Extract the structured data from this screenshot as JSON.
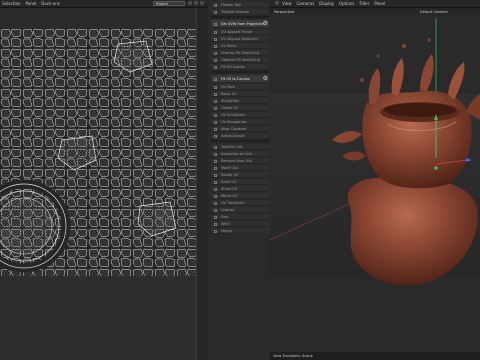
{
  "menubar": {
    "left_items": [
      "Selection",
      "Panel",
      "Dock-ons"
    ],
    "project_select": "Project",
    "right_items": [
      "View",
      "Cameras",
      "Display",
      "Options",
      "Filter",
      "Panel"
    ]
  },
  "tools": {
    "items": [
      {
        "label": "Flatten Tool"
      },
      {
        "label": "Triangle Unwrap"
      },
      {
        "label": "Set UVW from Projection",
        "highlight": true
      },
      {
        "label": "UV Aligned Planar"
      },
      {
        "label": "UV Aligned Spherical"
      },
      {
        "label": "UV Relax"
      },
      {
        "label": "Unwrap Fill Stretching"
      },
      {
        "label": "Optimal Fill Stretching"
      },
      {
        "label": "Fill UV Islands"
      },
      {
        "label": "Fit UV to Canvas",
        "highlight": true
      },
      {
        "label": "UV Pack"
      },
      {
        "label": "Relax UV"
      },
      {
        "label": "Straighten"
      },
      {
        "label": "Orient UV"
      },
      {
        "label": "UV Straighten"
      },
      {
        "label": "UV Reorganize"
      },
      {
        "label": "Align Coplanar"
      },
      {
        "label": "Island Layout"
      },
      {
        "label": "Transfer UVs"
      },
      {
        "label": "Normalize to Grid"
      },
      {
        "label": "Remove from UVs"
      },
      {
        "label": "Move UVs"
      },
      {
        "label": "Rotate UV"
      },
      {
        "label": "Scale UV"
      },
      {
        "label": "Shear UV"
      },
      {
        "label": "Mirror UV"
      },
      {
        "label": "UV Transform"
      },
      {
        "label": "Unwrap"
      },
      {
        "label": "Sew"
      },
      {
        "label": "Weld"
      },
      {
        "label": "Merge"
      }
    ]
  },
  "viewport": {
    "mode": "Perspective",
    "camera": "Default Camera",
    "side_label": "Move",
    "footer": "View Transform: Scene"
  },
  "colors": {
    "accent": "#5a8dd6",
    "uv_edge": "#d8d8d8",
    "chocolate": "#8a4a35"
  }
}
